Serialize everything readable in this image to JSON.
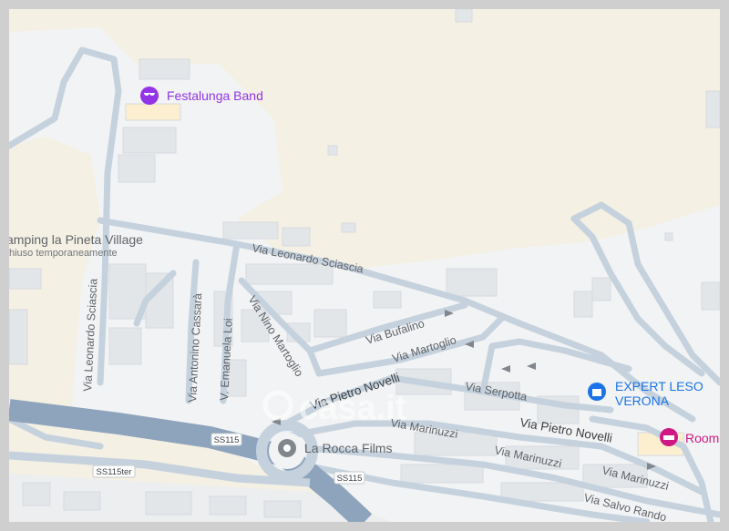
{
  "pois": {
    "festalunga": {
      "name": "Festalunga Band",
      "icon": "music-icon",
      "color": "#9334e6"
    },
    "camping": {
      "name": "amping la Pineta Village",
      "status": "hiuso temporaneamente"
    },
    "expert": {
      "line1": "EXPERT LESO",
      "line2": "VERONA",
      "icon": "shopping-bag-icon",
      "color": "#1a73e8"
    },
    "room": {
      "name": "Room",
      "icon": "bed-icon",
      "color": "#d01884"
    },
    "larocca": {
      "name": "La Rocca Films",
      "icon": "pin-icon"
    }
  },
  "streets": {
    "sciascia_main": "Via Leonardo Sciascia",
    "sciascia_vertical": "Via Leonardo Sciascia",
    "cassara": "Via Antonino Cassarà",
    "loi": "V. Emanuela Loi",
    "martoglio_nino": "Via Nino Martoglio",
    "bufalino": "Via Bufalino",
    "martoglio": "Via Martoglio",
    "novelli_left": "Via Pietro Novelli",
    "novelli_right": "Via Pietro Novelli",
    "serpotta": "Via Serpotta",
    "marinuzzi_1": "Via Marinuzzi",
    "marinuzzi_2": "Via Marinuzzi",
    "marinuzzi_3": "Via Marinuzzi",
    "salvo": "Via Salvo Rando"
  },
  "shields": {
    "ss115_a": "SS115",
    "ss115_b": "SS115",
    "ss115ter": "SS115ter"
  },
  "watermark": "casa.it",
  "colors": {
    "land": "#f2f3f4",
    "sand": "#f5f0e4",
    "road": "#c5d2de",
    "highway": "#8ea4bc",
    "building": "#e5e8eb"
  }
}
